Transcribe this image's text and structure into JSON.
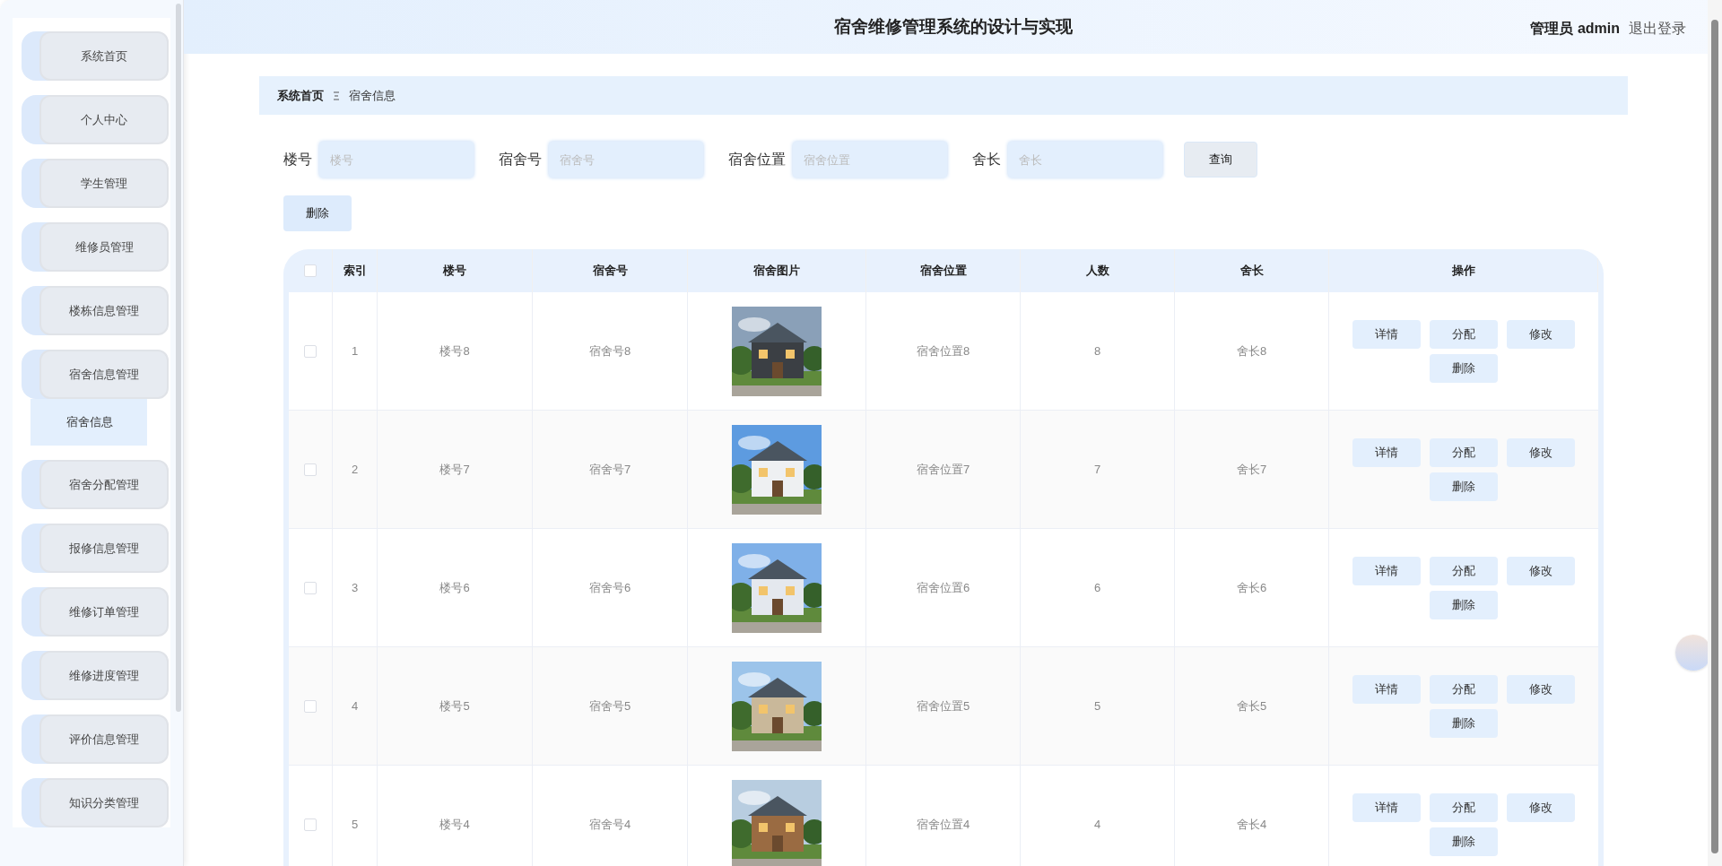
{
  "header": {
    "title": "宿舍维修管理系统的设计与实现",
    "user": "管理员 admin",
    "logout": "退出登录"
  },
  "sidebar": {
    "items": [
      {
        "label": "系统首页"
      },
      {
        "label": "个人中心"
      },
      {
        "label": "学生管理"
      },
      {
        "label": "维修员管理"
      },
      {
        "label": "楼栋信息管理"
      },
      {
        "label": "宿舍信息管理",
        "children": [
          {
            "label": "宿舍信息",
            "selected": true
          }
        ]
      },
      {
        "label": "宿舍分配管理"
      },
      {
        "label": "报修信息管理"
      },
      {
        "label": "维修订单管理"
      },
      {
        "label": "维修进度管理"
      },
      {
        "label": "评价信息管理"
      },
      {
        "label": "知识分类管理"
      }
    ]
  },
  "breadcrumb": [
    "系统首页",
    "宿舍信息"
  ],
  "search": {
    "fields": [
      {
        "label": "楼号",
        "placeholder": "楼号"
      },
      {
        "label": "宿舍号",
        "placeholder": "宿舍号"
      },
      {
        "label": "宿舍位置",
        "placeholder": "宿舍位置"
      },
      {
        "label": "舍长",
        "placeholder": "舍长"
      }
    ],
    "button": "查询"
  },
  "delete_button": "删除",
  "table": {
    "select_all": {
      "checked": false
    },
    "columns": [
      "索引",
      "楼号",
      "宿舍号",
      "宿舍图片",
      "宿舍位置",
      "人数",
      "舍长",
      "操作"
    ],
    "rows": [
      {
        "checked": false,
        "index": "1",
        "building": "楼号8",
        "room": "宿舍号8",
        "image": {
          "kind": "picture"
        },
        "location": "宿舍位置8",
        "count": "8",
        "leader": "舍长8",
        "actions": [
          "详情",
          "分配",
          "修改",
          "删除"
        ]
      },
      {
        "checked": false,
        "index": "2",
        "building": "楼号7",
        "room": "宿舍号7",
        "image": {
          "kind": "picture"
        },
        "location": "宿舍位置7",
        "count": "7",
        "leader": "舍长7",
        "actions": [
          "详情",
          "分配",
          "修改",
          "删除"
        ]
      },
      {
        "checked": false,
        "index": "3",
        "building": "楼号6",
        "room": "宿舍号6",
        "image": {
          "kind": "picture"
        },
        "location": "宿舍位置6",
        "count": "6",
        "leader": "舍长6",
        "actions": [
          "详情",
          "分配",
          "修改",
          "删除"
        ]
      },
      {
        "checked": false,
        "index": "4",
        "building": "楼号5",
        "room": "宿舍号5",
        "image": {
          "kind": "picture"
        },
        "location": "宿舍位置5",
        "count": "5",
        "leader": "舍长5",
        "actions": [
          "详情",
          "分配",
          "修改",
          "删除"
        ]
      },
      {
        "checked": false,
        "index": "5",
        "building": "楼号4",
        "room": "宿舍号4",
        "image": {
          "kind": "picture"
        },
        "location": "宿舍位置4",
        "count": "4",
        "leader": "舍长4",
        "actions": [
          "详情",
          "分配",
          "修改",
          "删除"
        ]
      }
    ]
  }
}
